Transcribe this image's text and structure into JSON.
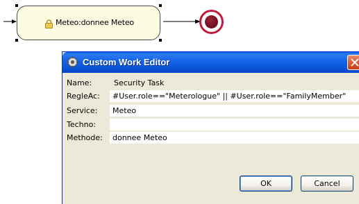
{
  "diagram": {
    "task_label": "Meteo:donnee Meteo",
    "colors": {
      "task_fill": "#fdfbe1",
      "end_event": "#c21b3a"
    }
  },
  "dialog": {
    "title": "Custom Work Editor",
    "fields": {
      "name": {
        "label": "Name:",
        "value": "Security Task"
      },
      "regleac": {
        "label": "RegleAc:",
        "value": "#User.role==\"Meterologue\" || #User.role==\"FamilyMember\""
      },
      "service": {
        "label": "Service:",
        "value": "Meteo"
      },
      "techno": {
        "label": "Techno:",
        "value": ""
      },
      "methode": {
        "label": "Methode:",
        "value": "donnee Meteo"
      }
    },
    "buttons": {
      "ok": "OK",
      "cancel": "Cancel"
    },
    "colors": {
      "titlebar": "#0b52d6",
      "background": "#ece9d8"
    }
  }
}
